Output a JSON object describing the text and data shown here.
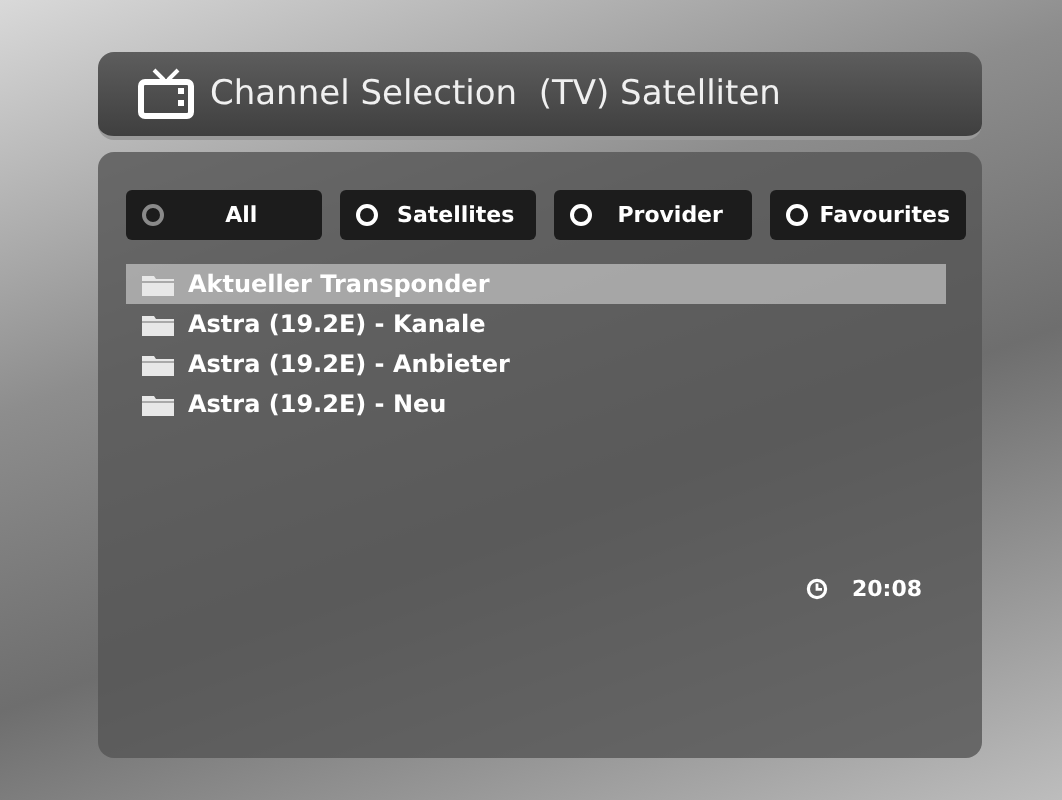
{
  "header": {
    "title": "Channel Selection  (TV) Satelliten"
  },
  "filter_buttons": [
    {
      "label": "All",
      "color": "#8a8a8a"
    },
    {
      "label": "Satellites",
      "color": "#ffffff"
    },
    {
      "label": "Provider",
      "color": "#ffffff"
    },
    {
      "label": "Favourites",
      "color": "#ffffff"
    }
  ],
  "list": [
    {
      "label": "Aktueller Transponder",
      "selected": true
    },
    {
      "label": "Astra (19.2E) - Kanale",
      "selected": false
    },
    {
      "label": "Astra (19.2E) - Anbieter",
      "selected": false
    },
    {
      "label": "Astra (19.2E) - Neu",
      "selected": false
    }
  ],
  "clock": {
    "time": "20:08"
  }
}
